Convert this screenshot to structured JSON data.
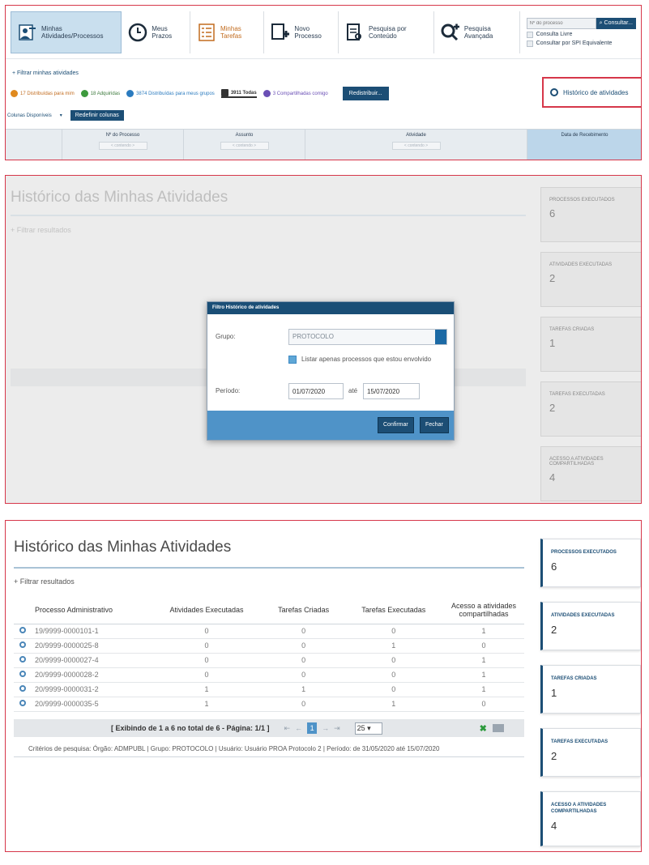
{
  "toolbar": {
    "items": [
      {
        "label": "Minhas Atividades/Processos",
        "icon": "user-tasks-icon"
      },
      {
        "label": "Meus Prazos",
        "icon": "clock-icon"
      },
      {
        "label": "Minhas Tarefas",
        "icon": "checklist-icon"
      },
      {
        "label": "Novo Processo",
        "icon": "new-document-icon"
      },
      {
        "label": "Pesquisa por Conteúdo",
        "icon": "document-search-icon"
      },
      {
        "label": "Pesquisa Avançada",
        "icon": "advanced-search-icon"
      }
    ],
    "search_placeholder": "Nº do processo",
    "consultar_label": "Consultar...",
    "consulta_livre": "Consulta Livre",
    "consultar_spi": "Consultar por SPI Equivalente"
  },
  "filter_link": "+ Filtrar minhas atividades",
  "stats": [
    {
      "label": "17 Distribuídas para mim",
      "color": "#e08a1e"
    },
    {
      "label": "18 Adquiridas",
      "color": "#3d9a3d"
    },
    {
      "label": "3874 Distribuídas para meus grupos",
      "color": "#2b7bbf"
    },
    {
      "label": "3911 Todas",
      "color": "#333333"
    },
    {
      "label": "3 Compartilhadas comigo",
      "color": "#6a4fb5"
    }
  ],
  "redistribuir_label": "Redistribuir...",
  "historico_label": "Histórico de atividades",
  "colunas_label": "Colunas Disponíveis",
  "redefinir_label": "Redefinir colunas",
  "grid_headers": [
    {
      "label": "Nº do Processo",
      "filter": "< contendo >"
    },
    {
      "label": "Assunto",
      "filter": "< contendo >"
    },
    {
      "label": "Atividade",
      "filter": "< contendo >"
    },
    {
      "label": "Data de Recebimento",
      "filter": ""
    }
  ],
  "modal": {
    "title": "Filtro Histórico de atividades",
    "grupo_label": "Grupo:",
    "grupo_value": "PROTOCOLO",
    "checkbox_label": "Listar apenas processos que estou envolvido",
    "periodo_label": "Período:",
    "date_from": "01/07/2020",
    "ate_label": "até",
    "date_to": "15/07/2020",
    "confirmar": "Confirmar",
    "fechar": "Fechar"
  },
  "page": {
    "title": "Histórico das Minhas Atividades",
    "filter_link": "+ Filtrar resultados",
    "columns": [
      "Processo Administrativo",
      "Atividades Executadas",
      "Tarefas Criadas",
      "Tarefas Executadas",
      "Acesso a atividades compartilhadas"
    ],
    "rows": [
      [
        "19/9999-0000101-1",
        "0",
        "0",
        "0",
        "1"
      ],
      [
        "20/9999-0000025-8",
        "0",
        "0",
        "1",
        "0"
      ],
      [
        "20/9999-0000027-4",
        "0",
        "0",
        "0",
        "1"
      ],
      [
        "20/9999-0000028-2",
        "0",
        "0",
        "0",
        "1"
      ],
      [
        "20/9999-0000031-2",
        "1",
        "1",
        "0",
        "1"
      ],
      [
        "20/9999-0000035-5",
        "1",
        "0",
        "1",
        "0"
      ]
    ],
    "pager_info": "[ Exibindo de 1 a 6 no total de 6 - Página: 1/1 ]",
    "current_page": "1",
    "page_size": "25",
    "criteria": "Critérios de pesquisa: Órgão: ADMPUBL | Grupo: PROTOCOLO | Usuário: Usuário PROA Protocolo 2 | Período: de 31/05/2020 até 15/07/2020"
  },
  "summary": [
    {
      "label": "PROCESSOS EXECUTADOS",
      "value": "6"
    },
    {
      "label": "ATIVIDADES EXECUTADAS",
      "value": "2"
    },
    {
      "label": "TAREFAS CRIADAS",
      "value": "1"
    },
    {
      "label": "TAREFAS EXECUTADAS",
      "value": "2"
    },
    {
      "label": "ACESSO A ATIVIDADES COMPARTILHADAS",
      "value": "4"
    }
  ]
}
